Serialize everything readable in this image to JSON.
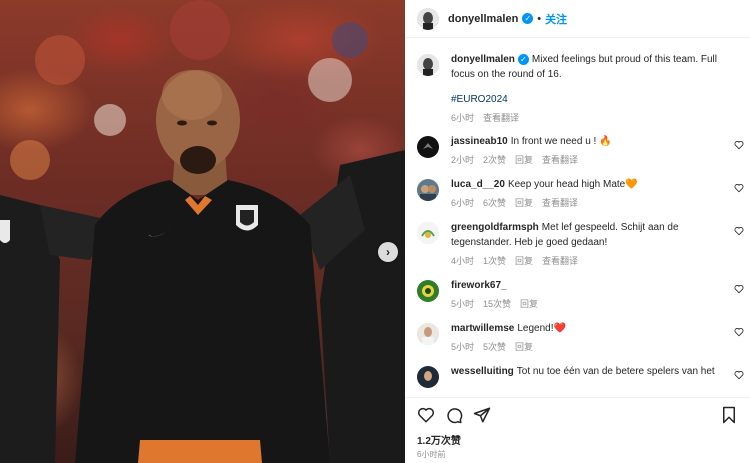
{
  "post": {
    "username": "donyellmalen",
    "follow_label": "关注",
    "separator": "•",
    "caption": "Mixed feelings but proud of this team. Full focus on the round of 16.",
    "hashtag": "#EURO2024",
    "caption_time": "6小时",
    "caption_translate": "查看翻译",
    "likes": "1.2万次赞",
    "time": "6小时前"
  },
  "comments": [
    {
      "username": "jassineab10",
      "text": "In front we need u ! 🔥",
      "time": "2小时",
      "likes": "2次赞",
      "reply": "回复",
      "translate": "查看翻译",
      "avatar_icon": "jassineab10-avatar"
    },
    {
      "username": "luca_d__20",
      "text": "Keep your head high Mate🧡",
      "time": "6小时",
      "likes": "6次赞",
      "reply": "回复",
      "translate": "查看翻译",
      "avatar_icon": "luca-avatar"
    },
    {
      "username": "greengoldfarmsph",
      "text": "Met lef gespeeld. Schijt aan de tegenstander. Heb je goed gedaan!",
      "time": "4小时",
      "likes": "1次赞",
      "reply": "回复",
      "translate": "查看翻译",
      "avatar_icon": "greengold-avatar"
    },
    {
      "username": "firework67_",
      "text": "",
      "time": "5小时",
      "likes": "15次赞",
      "reply": "回复",
      "translate": "",
      "avatar_icon": "firework-avatar"
    },
    {
      "username": "martwillemse",
      "text": "Legend!❤️",
      "time": "5小时",
      "likes": "5次赞",
      "reply": "回复",
      "translate": "",
      "avatar_icon": "martwillemse-avatar"
    },
    {
      "username": "wesselluiting",
      "text": "Tot nu toe één van de betere spelers van het",
      "time": "",
      "likes": "",
      "reply": "",
      "translate": "",
      "avatar_icon": "wesselluiting-avatar"
    }
  ],
  "icons": {
    "like": "heart-icon",
    "comment": "comment-icon",
    "share": "share-icon",
    "save": "bookmark-icon",
    "carousel": "chevron-right-icon",
    "verified": "verified-badge-icon"
  },
  "colors": {
    "accent": "#0095f6",
    "hashtag": "#00376b",
    "meta": "#8e8e8e"
  }
}
